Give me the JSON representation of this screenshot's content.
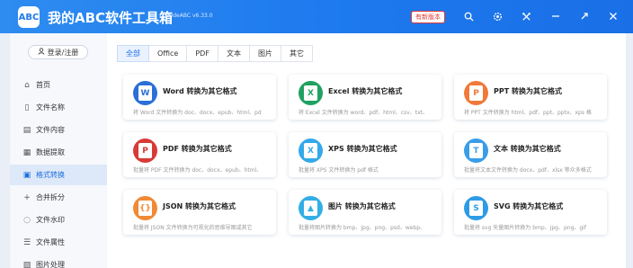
{
  "app": {
    "logo_text": "ABC",
    "title": "我的ABC软件工具箱",
    "version": "WodeABC v6.33.0",
    "new_version_label": "有新版本"
  },
  "titlebar_icons": [
    "search-icon",
    "settings-icon",
    "tools-icon",
    "minimize-icon",
    "maximize-icon",
    "close-icon"
  ],
  "sidebar": {
    "login_label": "登录/注册",
    "items": [
      {
        "label": "首页",
        "icon": "home-icon",
        "active": false
      },
      {
        "label": "文件名称",
        "icon": "file-name-icon",
        "active": false
      },
      {
        "label": "文件内容",
        "icon": "file-content-icon",
        "active": false
      },
      {
        "label": "数据提取",
        "icon": "data-extract-icon",
        "active": false
      },
      {
        "label": "格式转换",
        "icon": "format-convert-icon",
        "active": true
      },
      {
        "label": "合并拆分",
        "icon": "merge-split-icon",
        "active": false
      },
      {
        "label": "文件水印",
        "icon": "watermark-icon",
        "active": false
      },
      {
        "label": "文件属性",
        "icon": "file-property-icon",
        "active": false
      },
      {
        "label": "图片处理",
        "icon": "image-process-icon",
        "active": false
      }
    ]
  },
  "tabs": [
    {
      "label": "全部",
      "active": true
    },
    {
      "label": "Office",
      "active": false
    },
    {
      "label": "PDF",
      "active": false
    },
    {
      "label": "文本",
      "active": false
    },
    {
      "label": "图片",
      "active": false
    },
    {
      "label": "其它",
      "active": false
    }
  ],
  "cards": [
    {
      "title": "Word 转换为其它格式",
      "desc": "将 Word 文件转换为 doc、docx、epub、html、pd",
      "icon": "word-icon",
      "glyph": "W",
      "color": "#2b6fd8"
    },
    {
      "title": "Excel 转换为其它格式",
      "desc": "将 Excel 文件转换为 word、pdf、html、csv、txt、",
      "icon": "excel-icon",
      "glyph": "X",
      "color": "#20a162"
    },
    {
      "title": "PPT 转换为其它格式",
      "desc": "将 PPT 文件转换为 html、pdf、ppt、pptx、xps 格",
      "icon": "ppt-icon",
      "glyph": "P",
      "color": "#ef7a3a"
    },
    {
      "title": "PDF 转换为其它格式",
      "desc": "批量将 PDF 文件转换为 doc、docx、epub、html、",
      "icon": "pdf-icon",
      "glyph": "P",
      "color": "#d83a35"
    },
    {
      "title": "XPS 转换为其它格式",
      "desc": "批量将 XPS 文件转换为 pdf 格式",
      "icon": "xps-icon",
      "glyph": "X",
      "color": "#33a9ea"
    },
    {
      "title": "文本 转换为其它格式",
      "desc": "批量将文本文件转换为 docx、pdf、xlsx 等众多格式",
      "icon": "text-icon",
      "glyph": "T",
      "color": "#3a9de8"
    },
    {
      "title": "JSON 转换为其它格式",
      "desc": "批量将 JSON 文件转换为可视化的思维导图或其它",
      "icon": "json-icon",
      "glyph": "{}",
      "color": "#f08a35"
    },
    {
      "title": "图片 转换为其它格式",
      "desc": "批量将图片转换为 bmp、jpg、png、psd、webp、",
      "icon": "image-icon",
      "glyph": "▲",
      "color": "#33aee6"
    },
    {
      "title": "SVG 转换为其它格式",
      "desc": "批量将 svg 矢量图片转换为 bmp、jpg、png、gif",
      "icon": "svg-icon",
      "glyph": "S",
      "color": "#2e9be6"
    }
  ]
}
